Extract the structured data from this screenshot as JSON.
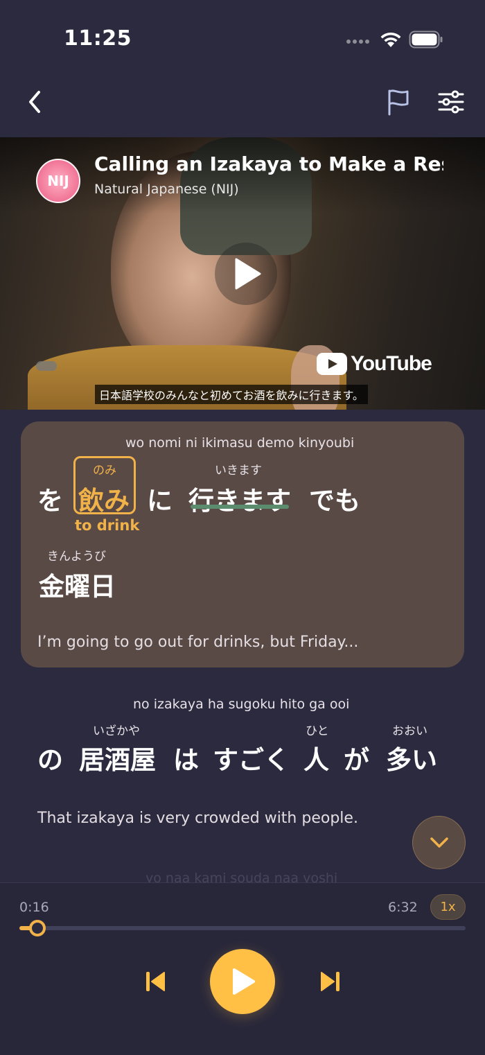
{
  "status_bar": {
    "time": "11:25"
  },
  "video": {
    "channel_badge": "NIJ",
    "title": "Calling an Izakaya to Make a Reservation",
    "channel": "Natural Japanese (NIJ)",
    "youtube_label": "YouTube",
    "subtitle": "日本語学校のみんなと初めてお酒を飲みに行きます。"
  },
  "active_line": {
    "romaji": "wo nomi ni ikimasu demo kinyoubi",
    "words": [
      {
        "text": "を",
        "furigana": ""
      },
      {
        "text": "飲み",
        "furigana": "のみ",
        "gloss": "to drink"
      },
      {
        "text": "に",
        "furigana": ""
      },
      {
        "text": "行きます",
        "furigana": "いきます"
      },
      {
        "text": "でも",
        "furigana": ""
      },
      {
        "text": "金曜日",
        "furigana": "きんようび"
      }
    ],
    "translation": "I’m going to go out for drinks, but Friday..."
  },
  "next_line": {
    "romaji": "no izakaya ha sugoku hito ga ooi",
    "words": [
      {
        "text": "の",
        "furigana": ""
      },
      {
        "text": "居酒屋",
        "furigana": "いざかや"
      },
      {
        "text": "は",
        "furigana": ""
      },
      {
        "text": "すごく",
        "furigana": ""
      },
      {
        "text": "人",
        "furigana": "ひと"
      },
      {
        "text": "が",
        "furigana": ""
      },
      {
        "text": "多い",
        "furigana": "おおい"
      }
    ],
    "translation": "That izakaya is very crowded with people."
  },
  "faded_line": {
    "romaji": "yo naa kami souda naa yoshi"
  },
  "player": {
    "current_time": "0:16",
    "total_time": "6:32",
    "speed": "1x",
    "progress": 0.041
  },
  "colors": {
    "background": "#2b2a3f",
    "accent": "#f2b24a",
    "card": "#594a45",
    "underline": "#5c8c6e"
  }
}
